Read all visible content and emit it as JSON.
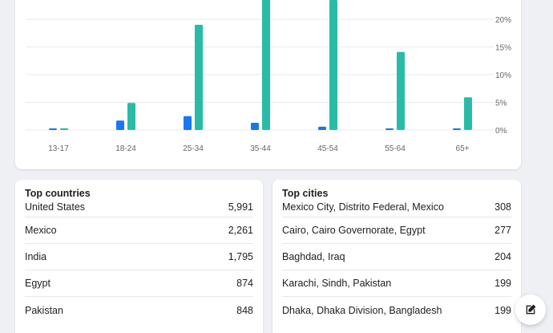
{
  "chart_data": {
    "type": "bar",
    "categories": [
      "13-17",
      "18-24",
      "25-34",
      "35-44",
      "45-54",
      "55-64",
      "65+"
    ],
    "series": [
      {
        "values": [
          0.2,
          1.7,
          2.5,
          1.3,
          0.6,
          0.2,
          0.2
        ],
        "color": "#1877f2"
      },
      {
        "values": [
          0.3,
          4.9,
          19.0,
          24.0,
          23.5,
          14.1,
          5.9
        ],
        "color": "#2abba7"
      }
    ],
    "y_ticks": [
      "0%",
      "5%",
      "10%",
      "15%",
      "20%"
    ],
    "y_tick_values": [
      0,
      5,
      10,
      15,
      20
    ],
    "ylim": [
      0,
      20
    ],
    "grid": true
  },
  "countries": {
    "title": "Top countries",
    "rows": [
      {
        "name": "United States",
        "value": "5,991"
      },
      {
        "name": "Mexico",
        "value": "2,261"
      },
      {
        "name": "India",
        "value": "1,795"
      },
      {
        "name": "Egypt",
        "value": "874"
      },
      {
        "name": "Pakistan",
        "value": "848"
      }
    ]
  },
  "cities": {
    "title": "Top cities",
    "rows": [
      {
        "name": "Mexico City, Distrito Federal, Mexico",
        "value": "308"
      },
      {
        "name": "Cairo, Cairo Governorate, Egypt",
        "value": "277"
      },
      {
        "name": "Baghdad, Iraq",
        "value": "204"
      },
      {
        "name": "Karachi, Sindh, Pakistan",
        "value": "199"
      },
      {
        "name": "Dhaka, Dhaka Division, Bangladesh",
        "value": "199"
      }
    ]
  },
  "fab": {
    "icon": "edit-icon"
  }
}
